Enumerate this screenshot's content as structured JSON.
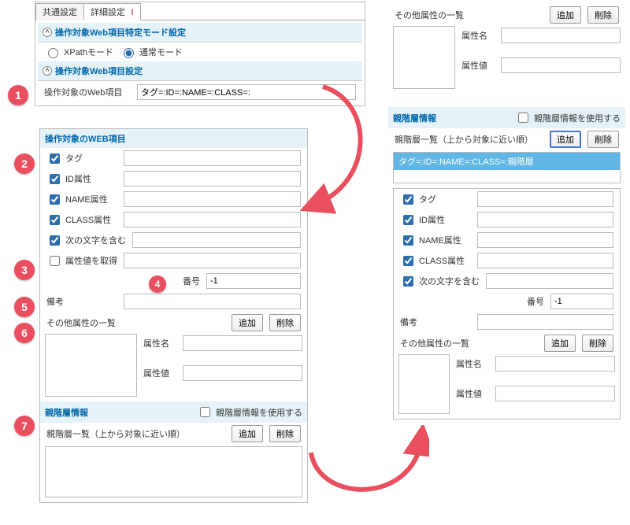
{
  "tabs": {
    "common": "共通設定",
    "detail": "詳細設定"
  },
  "left_top": {
    "mode_header": "操作対象Web項目特定モード設定",
    "radio_xpath": "XPathモード",
    "radio_normal": "通常モード",
    "item_header": "操作対象Web項目設定",
    "target_label": "操作対象のWeb項目",
    "target_value": "タグ=:ID=:NAME=:CLASS=:"
  },
  "left_panel": {
    "header": "操作対象のWEB項目",
    "chk_tag": "タグ",
    "chk_id": "ID属性",
    "chk_name": "NAME属性",
    "chk_class": "CLASS属性",
    "chk_text": "次の文字を含む",
    "chk_attrval": "属性値を取得",
    "number_label": "番号",
    "number_value": "-1",
    "remarks_label": "備考",
    "other_attr_label": "その他属性の一覧",
    "btn_add": "追加",
    "btn_del": "削除",
    "attr_name": "属性名",
    "attr_value": "属性値",
    "parent_title": "親階層情報",
    "use_parent": "親階層情報を使用する",
    "parent_list": "親階層一覧（上から対象に近い順）"
  },
  "right_top": {
    "other_attr_label": "その他属性の一覧",
    "btn_add": "追加",
    "btn_del": "削除",
    "attr_name": "属性名",
    "attr_value": "属性値"
  },
  "right_panel": {
    "parent_title": "親階層情報",
    "use_parent": "親階層情報を使用する",
    "parent_list": "親階層一覧（上から対象に近い順）",
    "btn_add": "追加",
    "btn_del": "削除",
    "highlight": "タグ=:ID=:NAME=:CLASS=:親階層",
    "chk_tag": "タグ",
    "chk_id": "ID属性",
    "chk_name": "NAME属性",
    "chk_class": "CLASS属性",
    "chk_text": "次の文字を含む",
    "number_label": "番号",
    "number_value": "-1",
    "remarks_label": "備考",
    "other_attr_label": "その他属性の一覧",
    "attr_name": "属性名",
    "attr_value": "属性値"
  },
  "steps": {
    "s1": "1",
    "s2": "2",
    "s3": "3",
    "s4": "4",
    "s5": "5",
    "s6": "6",
    "s7": "7"
  }
}
